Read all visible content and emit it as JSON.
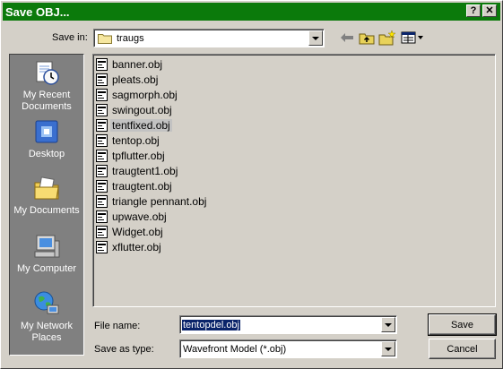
{
  "window": {
    "title": "Save OBJ..."
  },
  "titlebar_buttons": {
    "help": "?",
    "close": "✕"
  },
  "save_in": {
    "label": "Save in:",
    "value": "traugs"
  },
  "places": [
    {
      "label": "My Recent Documents",
      "icon": "recent-documents-icon"
    },
    {
      "label": "Desktop",
      "icon": "desktop-icon"
    },
    {
      "label": "My Documents",
      "icon": "my-documents-icon"
    },
    {
      "label": "My Computer",
      "icon": "my-computer-icon"
    },
    {
      "label": "My Network Places",
      "icon": "network-places-icon"
    }
  ],
  "files": [
    {
      "name": "banner.obj"
    },
    {
      "name": "pleats.obj"
    },
    {
      "name": "sagmorph.obj"
    },
    {
      "name": "swingout.obj"
    },
    {
      "name": "tentfixed.obj",
      "selected": true
    },
    {
      "name": "tentop.obj"
    },
    {
      "name": "tpflutter.obj"
    },
    {
      "name": "traugtent1.obj"
    },
    {
      "name": "traugtent.obj"
    },
    {
      "name": "triangle pennant.obj"
    },
    {
      "name": "upwave.obj"
    },
    {
      "name": "Widget.obj"
    },
    {
      "name": "xflutter.obj"
    }
  ],
  "file_name": {
    "label": "File name:",
    "value": "tentopdel.obj"
  },
  "save_as_type": {
    "label": "Save as type:",
    "value": "Wavefront Model (*.obj)"
  },
  "buttons": {
    "save": "Save",
    "cancel": "Cancel"
  },
  "colors": {
    "titlebar": "#0b7a0b",
    "face": "#d4d0c8",
    "places_bg": "#808080",
    "highlight": "#0a246a"
  }
}
